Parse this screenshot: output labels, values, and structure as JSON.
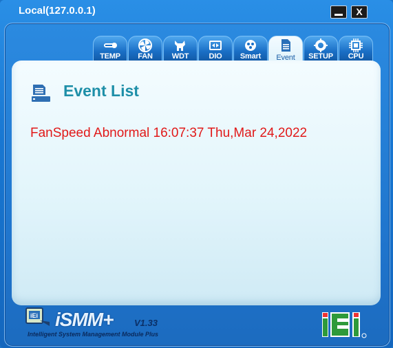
{
  "window": {
    "title": "Local(127.0.0.1)",
    "minimize_icon": "minimize-icon",
    "close_label": "X"
  },
  "tabs": [
    {
      "label": "TEMP",
      "icon": "thermometer-icon",
      "active": false
    },
    {
      "label": "FAN",
      "icon": "fan-icon",
      "active": false
    },
    {
      "label": "WDT",
      "icon": "watchdog-icon",
      "active": false
    },
    {
      "label": "DIO",
      "icon": "dio-icon",
      "active": false
    },
    {
      "label": "Smart",
      "icon": "smart-icon",
      "active": false
    },
    {
      "label": "Event",
      "icon": "event-icon",
      "active": true
    },
    {
      "label": "SETUP",
      "icon": "gear-icon",
      "active": false
    },
    {
      "label": "CPU",
      "icon": "cpu-icon",
      "active": false
    }
  ],
  "panel": {
    "title": "Event List",
    "icon": "event-list-icon",
    "events": [
      "FanSpeed Abnormal 16:07:37 Thu,Mar 24,2022"
    ]
  },
  "footer": {
    "product_logo": "iSMM+",
    "version": "V1.33",
    "tagline": "Intelligent System Management Module Plus",
    "brand_logo": "iEi"
  },
  "colors": {
    "title_accent": "#1e8fa8",
    "event_text": "#e11919",
    "window_blue": "#1f74cc"
  }
}
